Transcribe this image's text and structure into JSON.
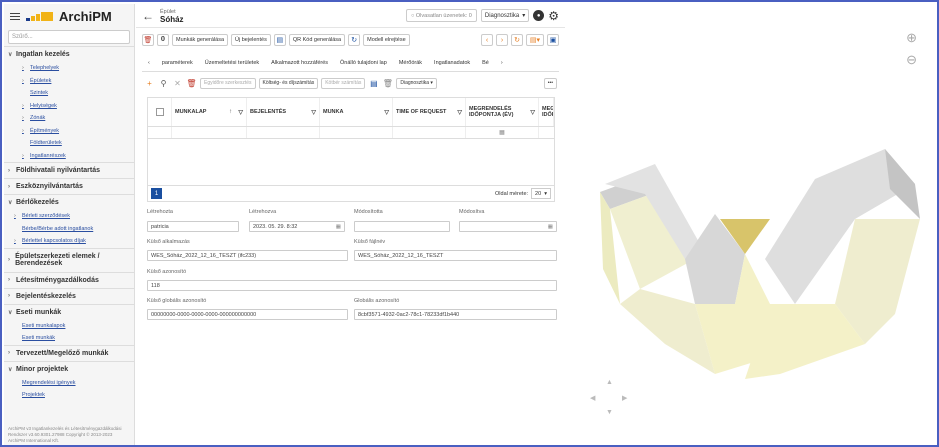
{
  "app": {
    "name": "ArchiPM"
  },
  "sidebar": {
    "search_placeholder": "Szűrő...",
    "sections": [
      {
        "label": "Ingatlan kezelés",
        "items": [
          "Telephelyek",
          "Épületek",
          "Szintek",
          "Helyiségek",
          "Zónák",
          "Építmények",
          "Földterületek",
          "Ingatlanrészek"
        ]
      },
      {
        "label": "Földhivatali nyilvántartás"
      },
      {
        "label": "Eszköznyilvántartás"
      },
      {
        "label": "Bérlőkezelés",
        "items": [
          "Bérleti szerződések",
          "Bérbe/Bérbe adott ingatlanok",
          "Bérlettel kapcsolatos díjak"
        ]
      },
      {
        "label": "Épületszerkezeti elemek / Berendezések"
      },
      {
        "label": "Létesítménygazdálkodás"
      },
      {
        "label": "Bejelentéskezelés"
      },
      {
        "label": "Eseti munkák",
        "items": [
          "Eseti munkalapok",
          "Eseti munkák"
        ]
      },
      {
        "label": "Tervezett/Megelőző munkák"
      },
      {
        "label": "Minor projektek",
        "items": [
          "Megrendelési igények",
          "Projektek"
        ]
      }
    ],
    "footer": "ArchiPM v3 Ingatlankezelés és Létesítménygazdálkodási Rendszer v3.60.9301.27988 Copyright © 2013-2023 ArchiPM International Kft."
  },
  "header": {
    "subtitle": "Épület",
    "title": "Sóház",
    "unread": "Olvasatlan üzenetek: 0",
    "diag": "Diagnosztika"
  },
  "toolbar": {
    "btn_munkak": "Munkák generálása",
    "btn_uj": "Új bejelentés",
    "btn_qr": "QR Kód generálása",
    "btn_modell": "Modell elrejtése"
  },
  "tabs": [
    "paraméterek",
    "Üzemeltetési területek",
    "Alkalmazott hozzáférés",
    "Önálló tulajdoni lap",
    "Mérőórák",
    "Ingatlanadatok",
    "Bé"
  ],
  "grid_toolbar": {
    "btn1": "Egyidőre szerkesztés",
    "btn2": "Költség- és díjszámítás",
    "btn3": "Kötbér számítás",
    "btn4": "Diagnosztika"
  },
  "grid": {
    "columns": [
      "MUNKALAP",
      "BEJELENTÉS",
      "MUNKA",
      "TIME OF REQUEST",
      "MEGRENDELÉS IDŐPONTJA (ÉV)",
      "MEGR. IDŐP."
    ],
    "page": "1",
    "page_size_label": "Oldal mérete:",
    "page_size": "20"
  },
  "form": {
    "letrehozta_label": "Létrehozta",
    "letrehozta": "patricia",
    "letrehozva_label": "Létrehozva",
    "letrehozva": "2023. 05. 29. 8:32",
    "modositotta_label": "Módosította",
    "modositotta": "",
    "modositva_label": "Módosítva",
    "modositva": "",
    "kulso_alk_label": "Külső alkalmazás",
    "kulso_alk": "WES_Sóház_2022_12_16_TESZT (ifc233)",
    "kulso_fajl_label": "Külső fájlnév",
    "kulso_fajl": "WES_Sóház_2022_12_16_TESZT",
    "kulso_az_label": "Külső azonosító",
    "kulso_az": "118",
    "kulso_glob_label": "Külső globális azonosító",
    "kulso_glob": "00000000-0000-0000-0000-000000000000",
    "glob_label": "Globális azonosító",
    "glob": "8cbf3571-4932-0ac2-78c1-78233df1b440"
  }
}
